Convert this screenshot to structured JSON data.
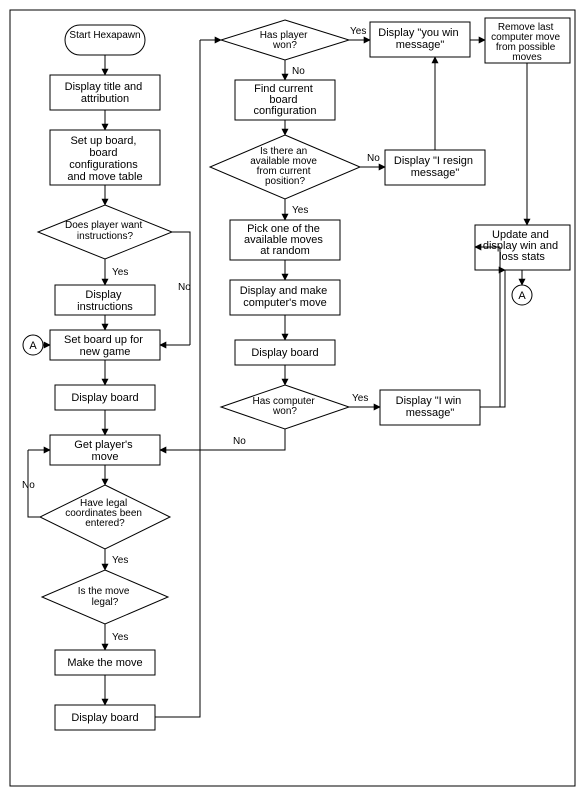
{
  "nodes": {
    "start": "Start Hexapawn",
    "title_attrib": "Display title and attribution",
    "setup_board": "Set up board, board configurations and move table",
    "want_instr": "Does player want instructions?",
    "display_instr": "Display instructions",
    "set_new_game": "Set board up for new game",
    "display_board1": "Display board",
    "get_move": "Get player's move",
    "legal_coords": "Have legal coordinates been entered?",
    "is_move_legal": "Is the move legal?",
    "make_move": "Make the move",
    "display_board3": "Display board",
    "has_player_won": "Has player won?",
    "find_config": "Find current board configuration",
    "avail_move": "Is there an available move from current position?",
    "pick_random": "Pick one of the available moves at random",
    "display_make_cpu": "Display and make computer's move",
    "display_board2": "Display board",
    "has_cpu_won": "Has computer won?",
    "you_win": "Display \"you win message\"",
    "remove_last": "Remove last computer move from possible moves",
    "i_resign": "Display \"I resign message\"",
    "update_stats": "Update and display win and loss stats",
    "i_win": "Display \"I win message\"",
    "connector_a": "A"
  },
  "labels": {
    "yes": "Yes",
    "no": "No"
  }
}
